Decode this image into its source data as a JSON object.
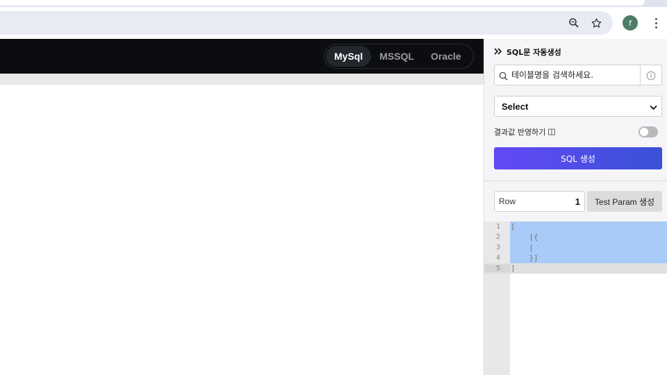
{
  "browser": {
    "icons": [
      "zoom-icon",
      "star-icon"
    ],
    "profile_initial": "f",
    "accent": "#4e7d66"
  },
  "header": {
    "db_options": [
      {
        "label": "MySql",
        "active": true
      },
      {
        "label": "MSSQL",
        "active": false
      },
      {
        "label": "Oracle",
        "active": false
      }
    ]
  },
  "panel": {
    "title": "SQL문 자동생성",
    "search_placeholder": "테이블명을 검색하세요.",
    "select_value": "Select",
    "toggle_label": "결과값 반영하기",
    "toggle_on": false,
    "generate_label": "SQL 생성",
    "generate_colors": [
      "#6349f5",
      "#3a51d6"
    ],
    "row_label": "Row",
    "row_value": "1",
    "param_button_label": "Test Param 생성"
  },
  "editor": {
    "lines": [
      {
        "n": "1",
        "code": "["
      },
      {
        "n": "2",
        "code": "    [{"
      },
      {
        "n": "3",
        "code": "    |"
      },
      {
        "n": "4",
        "code": "    }]"
      },
      {
        "n": "5",
        "code": "]"
      }
    ],
    "selection_color": "#a9cbf7"
  }
}
